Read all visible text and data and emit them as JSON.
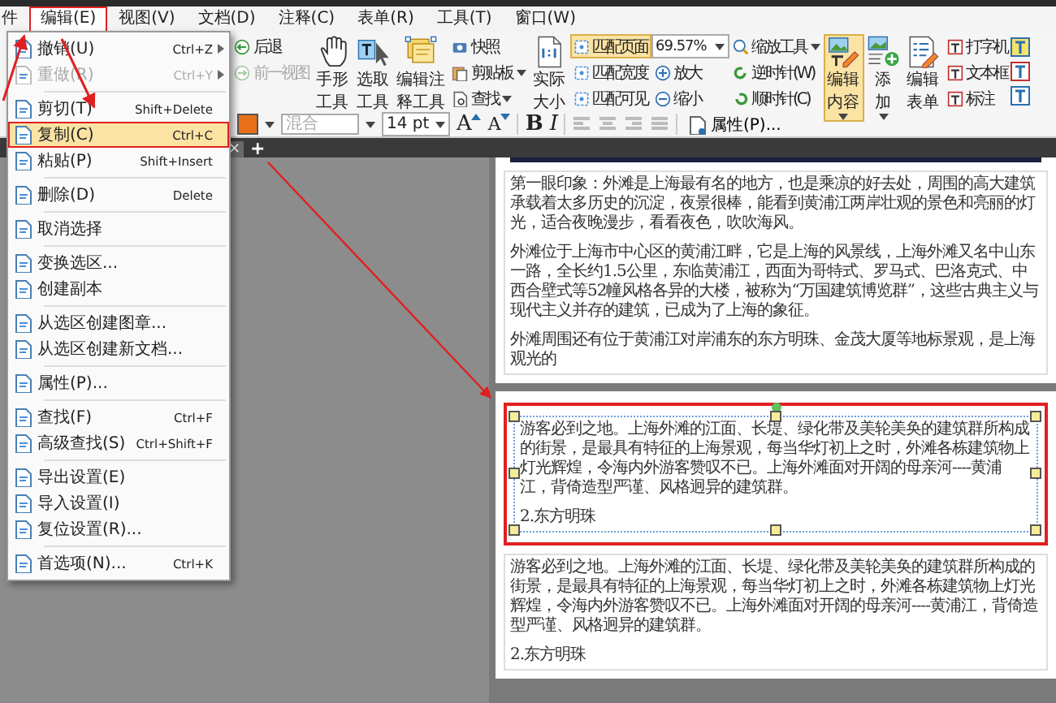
{
  "menu_bar": {
    "items": [
      {
        "label": "件",
        "selected": false
      },
      {
        "label": "编辑(E)",
        "selected": true
      },
      {
        "label": "视图(V)",
        "selected": false
      },
      {
        "label": "文档(D)",
        "selected": false
      },
      {
        "label": "注释(C)",
        "selected": false
      },
      {
        "label": "表单(R)",
        "selected": false
      },
      {
        "label": "工具(T)",
        "selected": false
      },
      {
        "label": "窗口(W)",
        "selected": false
      }
    ]
  },
  "ribbon": {
    "columns": [
      {
        "kind": "stack",
        "items": [
          {
            "label": "后退",
            "disabled": false,
            "dropdown": false
          },
          {
            "label": "前一视图",
            "disabled": true,
            "dropdown": false
          }
        ]
      },
      {
        "kind": "large",
        "label": "手形工具",
        "selected": false,
        "dropdown": false
      },
      {
        "kind": "large",
        "label": "选取工具",
        "selected": false,
        "dropdown": false
      },
      {
        "kind": "large",
        "label": "编辑注释工具",
        "selected": false,
        "dropdown": false
      },
      {
        "kind": "stack",
        "items": [
          {
            "label": "快照",
            "disabled": false,
            "dropdown": false
          },
          {
            "label": "剪贴板",
            "disabled": false,
            "dropdown": true
          },
          {
            "label": "查找",
            "disabled": false,
            "dropdown": true
          }
        ]
      },
      {
        "kind": "large",
        "label": "实际大小",
        "selected": false,
        "dropdown": false
      },
      {
        "kind": "stack",
        "items": [
          {
            "label": "匹配页面",
            "selected": true,
            "dropdown": false
          },
          {
            "label": "匹配宽度",
            "selected": false,
            "dropdown": false
          },
          {
            "label": "匹配可见",
            "selected": false,
            "dropdown": false
          }
        ]
      },
      {
        "kind": "zoom",
        "value": "69.57%",
        "items": [
          {
            "label": "放大",
            "dropdown": false
          },
          {
            "label": "缩小",
            "dropdown": false
          }
        ]
      },
      {
        "kind": "stack",
        "items": [
          {
            "label": "缩放工具",
            "disabled": false,
            "dropdown": true
          },
          {
            "label": "逆时针(W)",
            "disabled": false,
            "dropdown": false
          },
          {
            "label": "顺时针(C)",
            "disabled": false,
            "dropdown": false
          }
        ]
      },
      {
        "kind": "large",
        "label": "编辑内容",
        "selected": true,
        "dropdown": true
      },
      {
        "kind": "large",
        "label": "添加",
        "selected": false,
        "dropdown": true
      },
      {
        "kind": "large",
        "label": "编辑表单",
        "selected": false,
        "dropdown": false
      },
      {
        "kind": "stack",
        "items": [
          {
            "label": "打字机",
            "disabled": false,
            "dropdown": false
          },
          {
            "label": "文本框",
            "disabled": false,
            "dropdown": false
          },
          {
            "label": "标注",
            "disabled": false,
            "dropdown": false
          }
        ]
      },
      {
        "kind": "icons"
      }
    ]
  },
  "format_bar": {
    "font": {
      "placeholder": "混合"
    },
    "size": {
      "value": "14 pt"
    },
    "grow_font": "A",
    "shrink_font": "A",
    "bold": "B",
    "italic": "I",
    "properties_button": "属性(P)..."
  },
  "tab_strip": {
    "close": "×",
    "new_tab": "+"
  },
  "edit_menu": {
    "items": [
      {
        "kind": "item",
        "label": "撤销(U)",
        "shortcut": "Ctrl+Z",
        "submenu": true,
        "disabled": false,
        "selected": false
      },
      {
        "kind": "item",
        "label": "重做(R)",
        "shortcut": "Ctrl+Y",
        "submenu": true,
        "disabled": true,
        "selected": false
      },
      {
        "kind": "separator"
      },
      {
        "kind": "item",
        "label": "剪切(T)",
        "shortcut": "Shift+Delete",
        "submenu": false,
        "disabled": false,
        "selected": false
      },
      {
        "kind": "item",
        "label": "复制(C)",
        "shortcut": "Ctrl+C",
        "submenu": false,
        "disabled": false,
        "selected": true
      },
      {
        "kind": "item",
        "label": "粘贴(P)",
        "shortcut": "Shift+Insert",
        "submenu": false,
        "disabled": false,
        "selected": false
      },
      {
        "kind": "separator"
      },
      {
        "kind": "item",
        "label": "删除(D)",
        "shortcut": "Delete",
        "submenu": false,
        "disabled": false,
        "selected": false
      },
      {
        "kind": "separator"
      },
      {
        "kind": "item",
        "label": "取消选择",
        "submenu": false,
        "disabled": false,
        "selected": false
      },
      {
        "kind": "separator"
      },
      {
        "kind": "item",
        "label": "变换选区...",
        "submenu": false,
        "disabled": false,
        "selected": false
      },
      {
        "kind": "item",
        "label": "创建副本",
        "submenu": false,
        "disabled": false,
        "selected": false
      },
      {
        "kind": "separator"
      },
      {
        "kind": "item",
        "label": "从选区创建图章...",
        "submenu": false,
        "disabled": false,
        "selected": false
      },
      {
        "kind": "item",
        "label": "从选区创建新文档...",
        "submenu": false,
        "disabled": false,
        "selected": false
      },
      {
        "kind": "separator"
      },
      {
        "kind": "item",
        "label": "属性(P)...",
        "submenu": false,
        "disabled": false,
        "selected": false
      },
      {
        "kind": "separator"
      },
      {
        "kind": "item",
        "label": "查找(F)",
        "shortcut": "Ctrl+F",
        "submenu": false,
        "disabled": false,
        "selected": false
      },
      {
        "kind": "item",
        "label": "高级查找(S)",
        "shortcut": "Ctrl+Shift+F",
        "submenu": false,
        "disabled": false,
        "selected": false
      },
      {
        "kind": "separator"
      },
      {
        "kind": "item",
        "label": "导出设置(E)",
        "submenu": false,
        "disabled": false,
        "selected": false
      },
      {
        "kind": "item",
        "label": "导入设置(I)",
        "submenu": false,
        "disabled": false,
        "selected": false
      },
      {
        "kind": "item",
        "label": "复位设置(R)...",
        "submenu": false,
        "disabled": false,
        "selected": false
      },
      {
        "kind": "separator"
      },
      {
        "kind": "item",
        "label": "首选项(N)...",
        "shortcut": "Ctrl+K",
        "submenu": false,
        "disabled": false,
        "selected": false
      }
    ]
  },
  "document": {
    "pages": [
      {
        "blocks": [
          {
            "selected": false,
            "paragraphs": [
              "第一眼印象：外滩是上海最有名的地方，也是乘凉的好去处，周围的高大建筑承载着太多历史的沉淀，夜景很棒，能看到黄浦江两岸壮观的景色和亮丽的灯光，适合夜晚漫步，看看夜色，吹吹海风。",
              "外滩位于上海市中心区的黄浦江畔，它是上海的风景线，上海外滩又名中山东一路，全长约1.5公里，东临黄浦江，西面为哥特式、罗马式、巴洛克式、中西合壁式等52幢风格各异的大楼，被称为“万国建筑博览群”，这些古典主义与现代主义并存的建筑，已成为了上海的象征。",
              "外滩周围还有位于黄浦江对岸浦东的东方明珠、金茂大厦等地标景观，是上海观光的"
            ]
          }
        ]
      },
      {
        "blocks": [
          {
            "selected": true,
            "paragraphs": [
              "游客必到之地。上海外滩的江面、长堤、绿化带及美轮美奂的建筑群所构成的街景，是最具有特征的上海景观，每当华灯初上之时，外滩各栋建筑物上灯光辉煌，令海内外游客赞叹不已。上海外滩面对开阔的母亲河----黄浦江，背倚造型严谨、风格迥异的建筑群。",
              "2.东方明珠"
            ]
          },
          {
            "selected": false,
            "paragraphs": [
              "游客必到之地。上海外滩的江面、长堤、绿化带及美轮美奂的建筑群所构成的街景，是最具有特征的上海景观，每当华灯初上之时，外滩各栋建筑物上灯光辉煌，令海内外游客赞叹不已。上海外滩面对开阔的母亲河----黄浦江，背倚造型严谨、风格迥异的建筑群。",
              "2.东方明珠"
            ]
          }
        ]
      }
    ]
  }
}
